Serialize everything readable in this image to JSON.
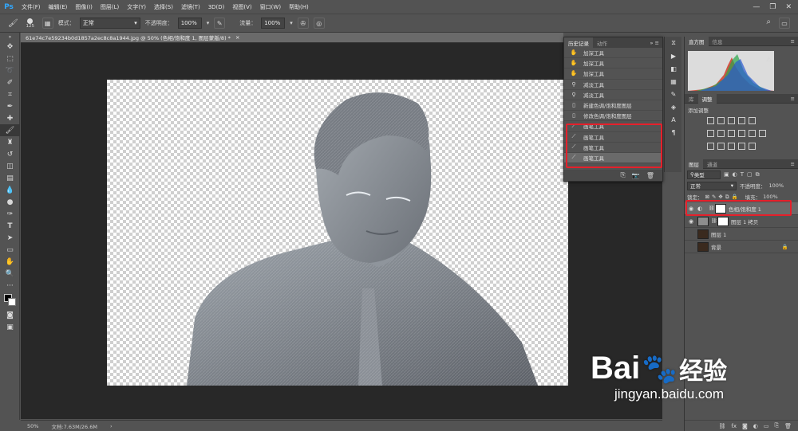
{
  "app": {
    "logo": "Ps",
    "accent": "#31a8ff",
    "highlight": "#e5202b"
  },
  "menu": [
    "文件(F)",
    "编辑(E)",
    "图像(I)",
    "图层(L)",
    "文字(Y)",
    "选择(S)",
    "滤镜(T)",
    "3D(D)",
    "视图(V)",
    "窗口(W)",
    "帮助(H)"
  ],
  "options": {
    "brush_size": "125",
    "mode_label": "模式：",
    "mode_value": "正常",
    "opacity_label": "不透明度：",
    "opacity_value": "100%",
    "flow_label": "流量：",
    "flow_value": "100%"
  },
  "document": {
    "tab_title": "61e74c7e59234b0d1857a2ec8c8a1944.jpg @ 50% (色相/饱和度 1, 图层蒙版/8) *",
    "zoom": "50%",
    "doc_size": "文档:7.63M/26.6M"
  },
  "history": {
    "tabs": [
      "历史记录",
      "动作"
    ],
    "items": [
      {
        "label": "加深工具",
        "icon": "burn-icon"
      },
      {
        "label": "加深工具",
        "icon": "burn-icon"
      },
      {
        "label": "加深工具",
        "icon": "burn-icon"
      },
      {
        "label": "减淡工具",
        "icon": "dodge-icon"
      },
      {
        "label": "减淡工具",
        "icon": "dodge-icon"
      },
      {
        "label": "新建色调/饱和度图层",
        "icon": "doc-icon"
      },
      {
        "label": "修改色调/饱和度图层",
        "icon": "doc-icon"
      },
      {
        "label": "画笔工具",
        "icon": "brush-icon"
      },
      {
        "label": "画笔工具",
        "icon": "brush-icon"
      },
      {
        "label": "画笔工具",
        "icon": "brush-icon"
      },
      {
        "label": "画笔工具",
        "icon": "brush-icon"
      }
    ]
  },
  "histogram": {
    "tabs": [
      "直方图",
      "信息"
    ]
  },
  "adjust": {
    "tabs": [
      "库",
      "调整"
    ],
    "title": "添加调整"
  },
  "layers": {
    "tabs": [
      "图层",
      "通道"
    ],
    "filter_label": "类型",
    "blend_mode": "正常",
    "opacity_label": "不透明度：",
    "opacity_value": "100%",
    "lock_label": "锁定：",
    "fill_label": "填充：",
    "fill_value": "100%",
    "items": [
      {
        "name": "色相/饱和度 1",
        "visible": true,
        "selected": true
      },
      {
        "name": "图层 1 拷贝",
        "visible": true,
        "selected": false
      },
      {
        "name": "图层 1",
        "visible": false,
        "selected": false
      },
      {
        "name": "背景",
        "visible": false,
        "selected": false
      }
    ]
  },
  "watermark": {
    "brand": "Bai",
    "brand2": "经验",
    "url": "jingyan.baidu.com"
  }
}
